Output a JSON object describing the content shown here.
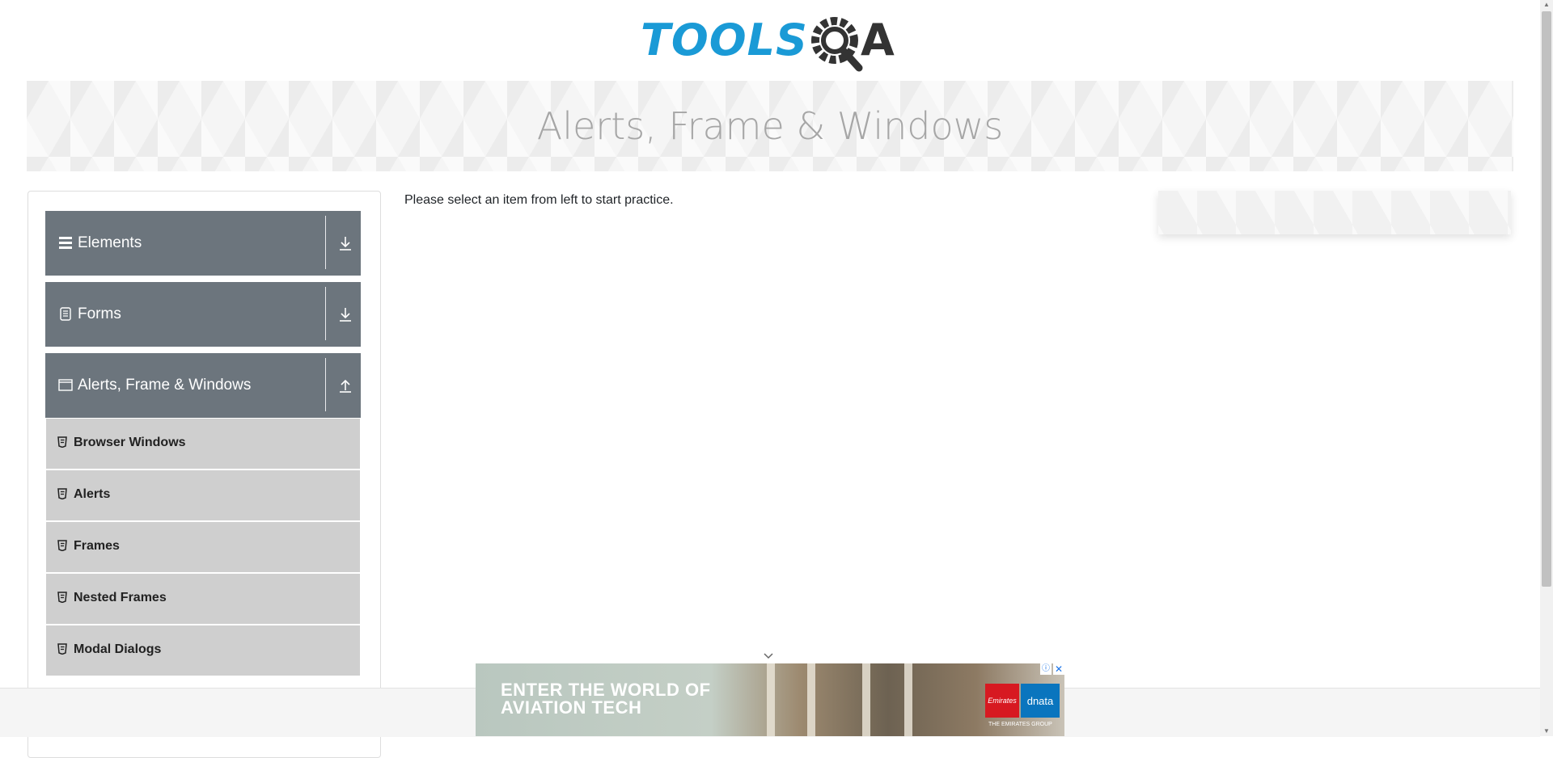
{
  "header": {
    "logo_left": "TOOLS",
    "logo_right": "A"
  },
  "banner": {
    "title": "Alerts, Frame & Windows"
  },
  "sidebar": {
    "groups": [
      {
        "label": "Elements",
        "icon": "hamburger-icon",
        "state": "collapsed"
      },
      {
        "label": "Forms",
        "icon": "form-icon",
        "state": "collapsed"
      },
      {
        "label": "Alerts, Frame & Windows",
        "icon": "window-icon",
        "state": "expanded"
      }
    ],
    "items": [
      {
        "label": "Browser Windows",
        "icon": "html5-icon"
      },
      {
        "label": "Alerts",
        "icon": "html5-icon"
      },
      {
        "label": "Frames",
        "icon": "html5-icon"
      },
      {
        "label": "Nested Frames",
        "icon": "html5-icon"
      },
      {
        "label": "Modal Dialogs",
        "icon": "html5-icon"
      }
    ]
  },
  "main": {
    "message": "Please select an item from left to start practice."
  },
  "ad": {
    "headline": "ENTER THE WORLD OF AVIATION TECH",
    "brand_1": "Emirates",
    "brand_2": "dnata",
    "group": "THE EMIRATES GROUP",
    "close": "✕",
    "info": "ⓘ"
  },
  "colors": {
    "logo_blue": "#1a9ad6",
    "group_header": "#6c757d",
    "menu_item": "#cfcfcf"
  }
}
